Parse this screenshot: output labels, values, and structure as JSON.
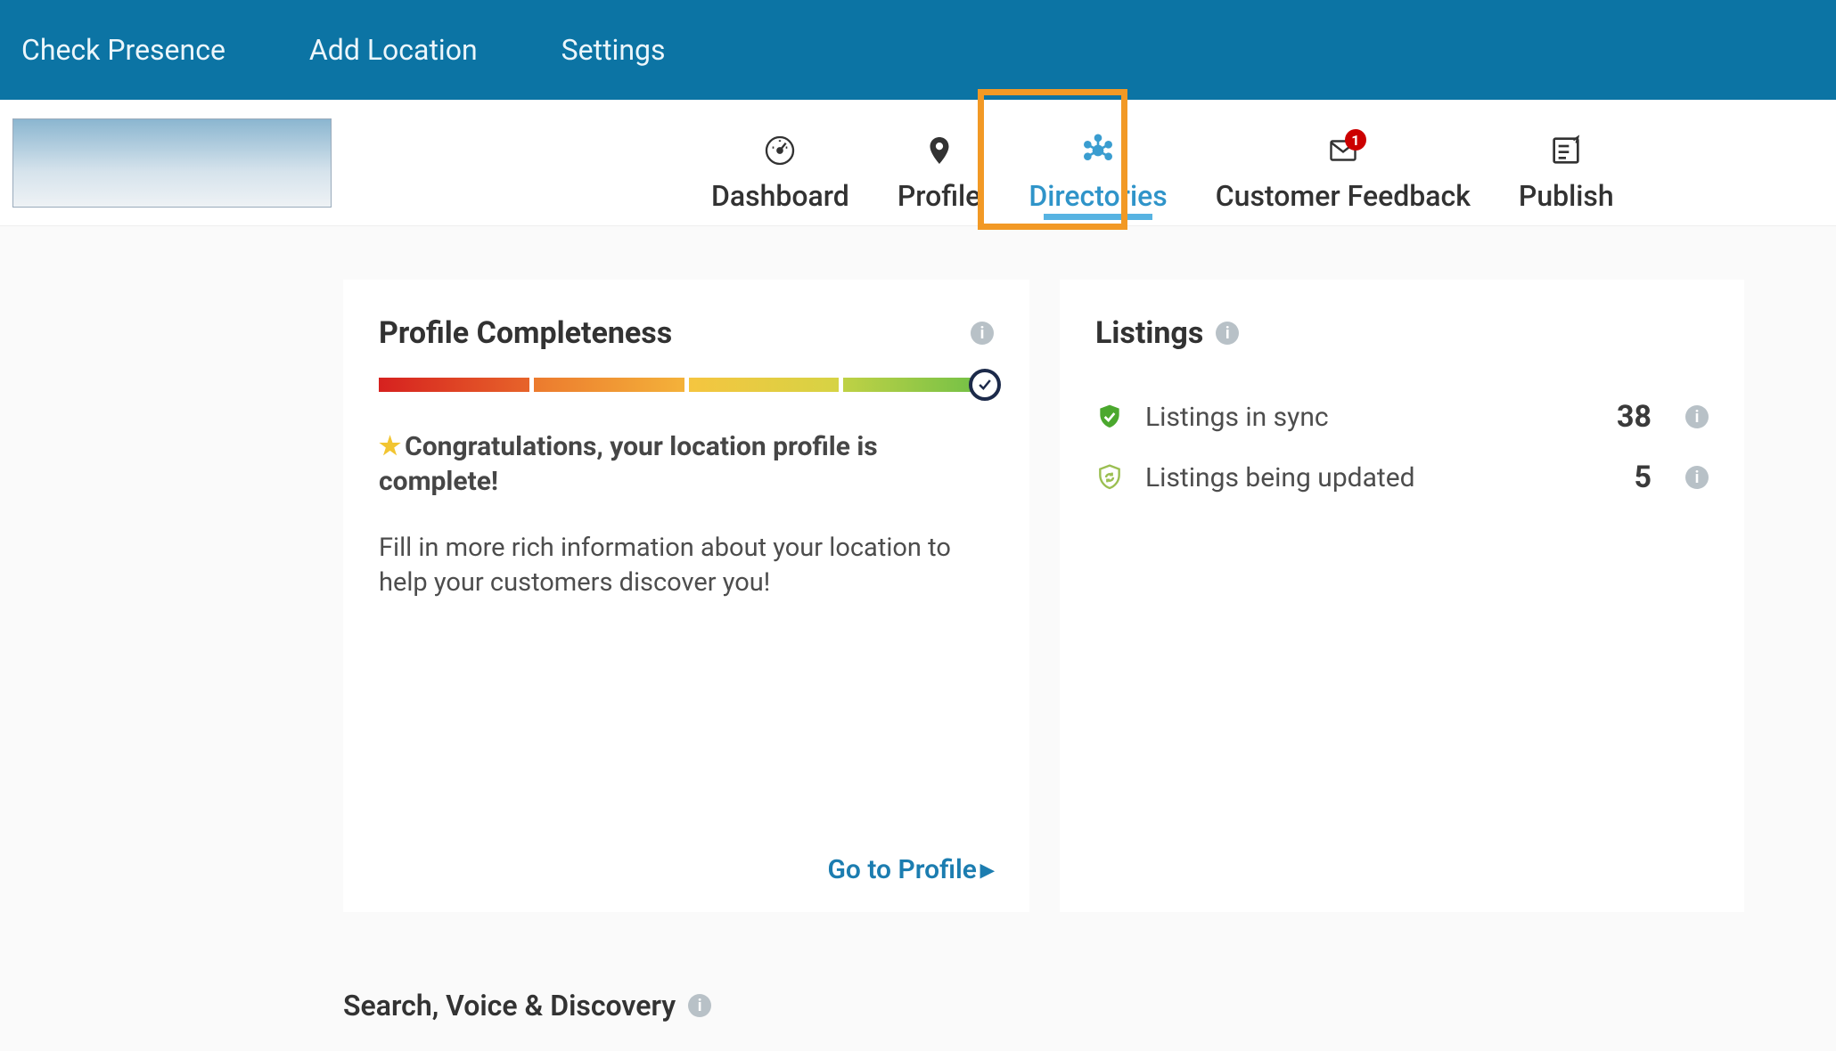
{
  "topbar": {
    "items": [
      "Check Presence",
      "Add Location",
      "Settings"
    ]
  },
  "tabs": [
    {
      "label": "Dashboard",
      "active": false
    },
    {
      "label": "Profile",
      "active": false
    },
    {
      "label": "Directories",
      "active": true
    },
    {
      "label": "Customer Feedback",
      "active": false,
      "badge": "1"
    },
    {
      "label": "Publish",
      "active": false
    }
  ],
  "profile_card": {
    "title": "Profile Completeness",
    "congrats": "Congratulations, your location profile is complete!",
    "desc": "Fill in more rich information about your location to help your customers discover you!",
    "cta": "Go to Profile"
  },
  "listings_card": {
    "title": "Listings",
    "rows": [
      {
        "label": "Listings in sync",
        "value": "38"
      },
      {
        "label": "Listings being updated",
        "value": "5"
      }
    ]
  },
  "section_heading": "Search, Voice & Discovery"
}
